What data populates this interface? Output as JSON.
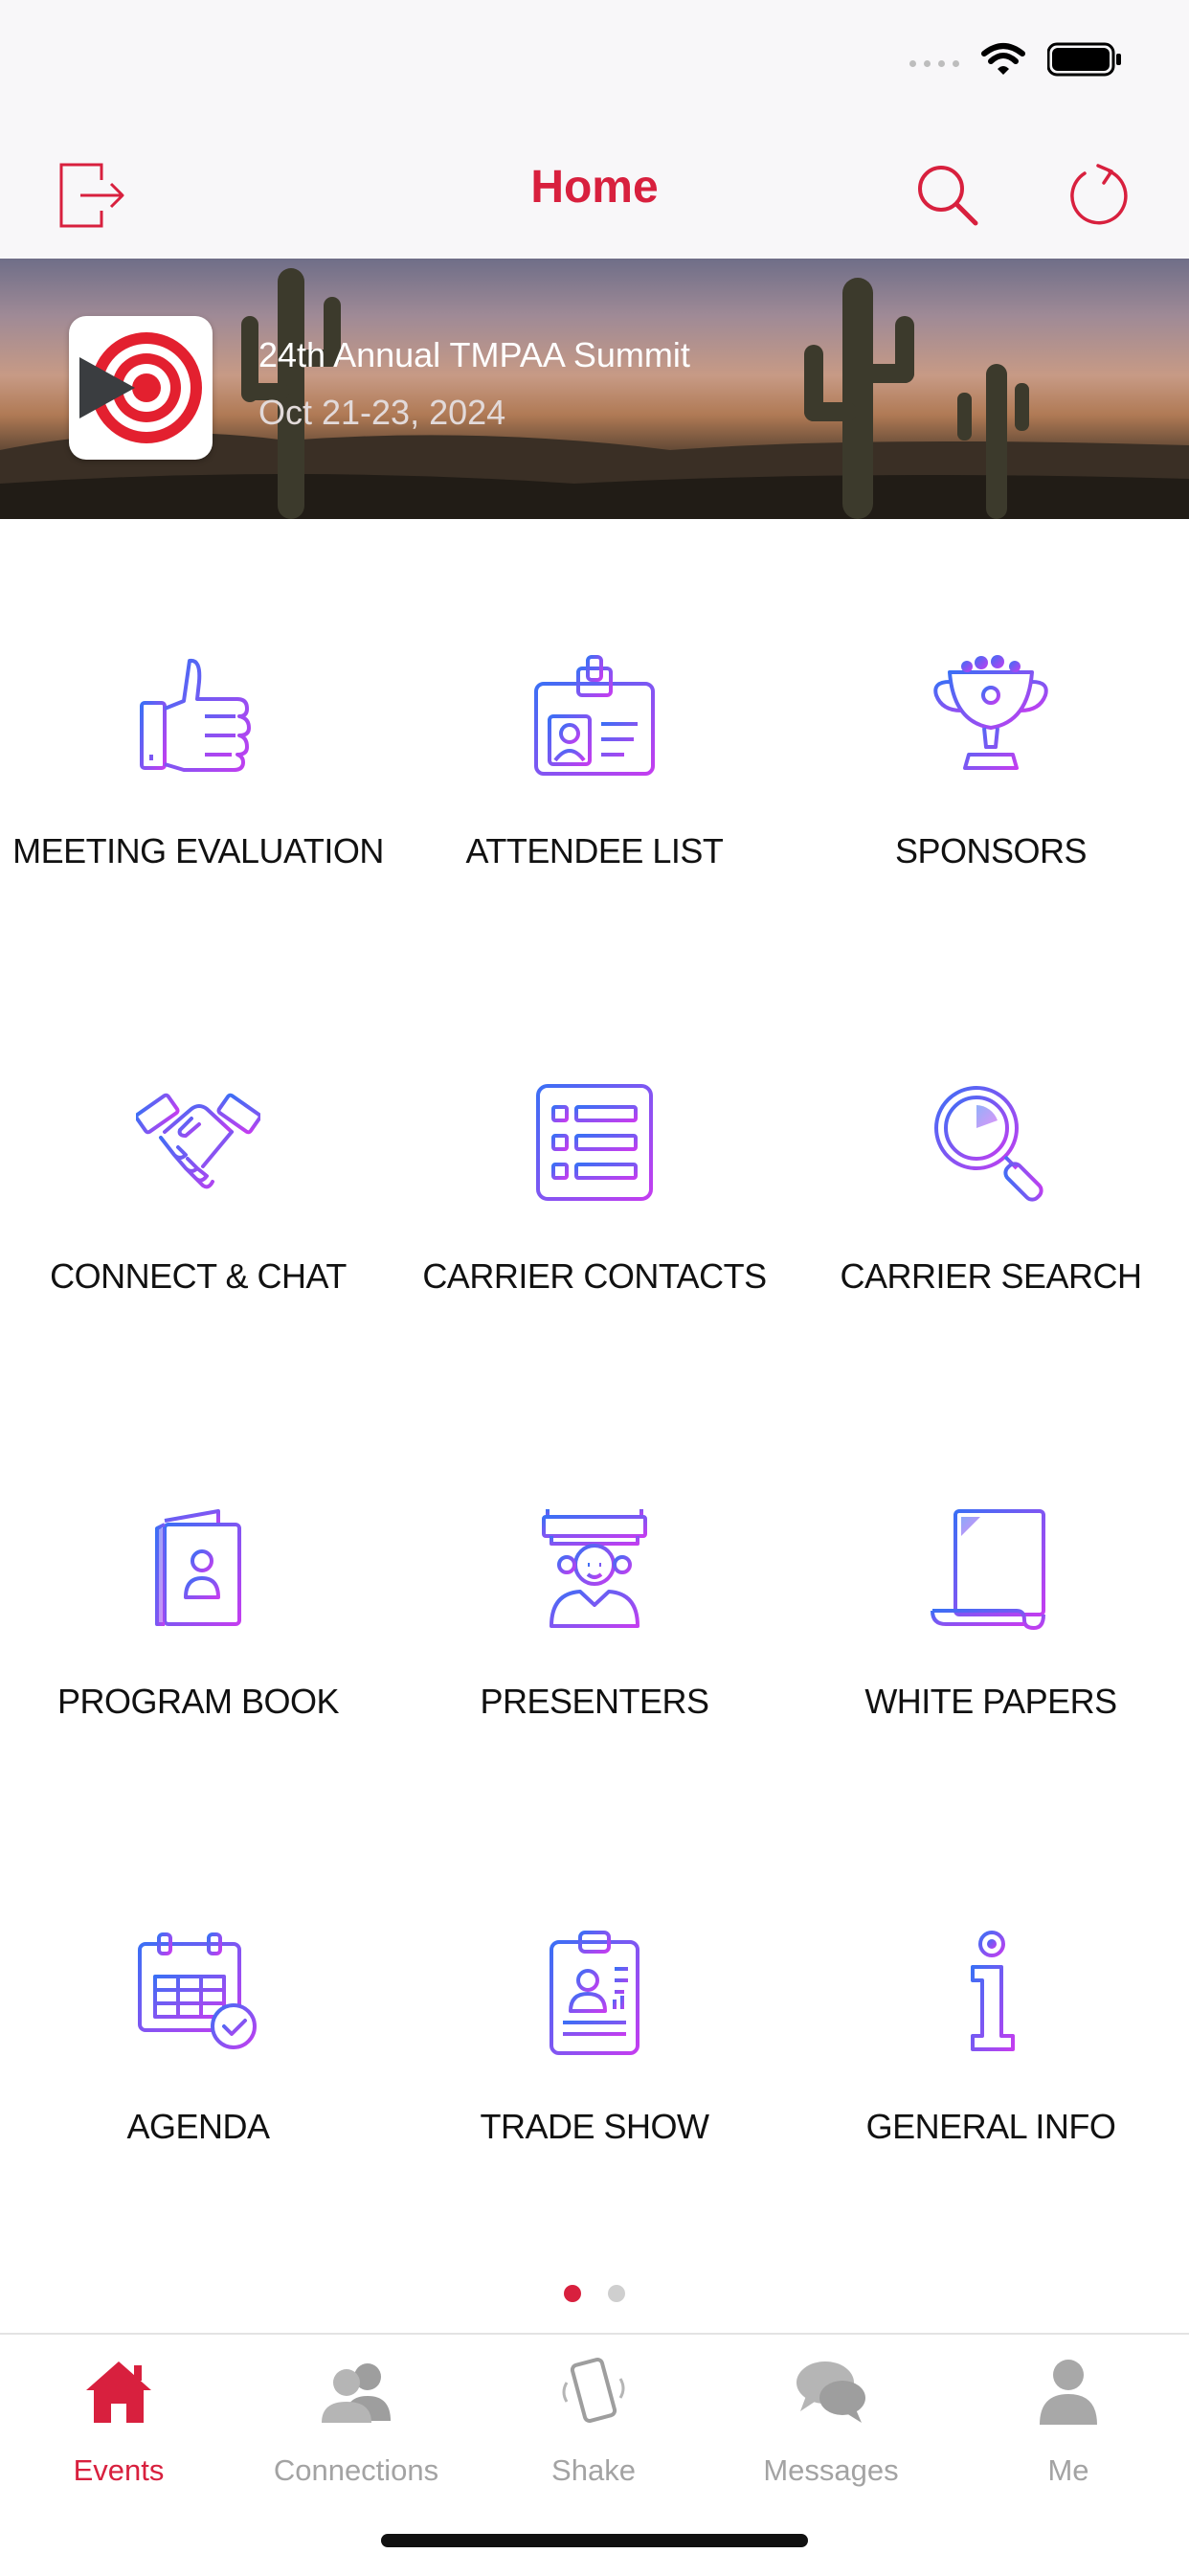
{
  "colors": {
    "accent": "#d8203e",
    "icon_gradient_start": "#3b6ff5",
    "icon_gradient_end": "#c43df0",
    "tab_inactive": "#a3a3a3"
  },
  "status_bar": {
    "icons": [
      "signal-dots-icon",
      "wifi-icon",
      "battery-icon"
    ]
  },
  "nav": {
    "title": "Home",
    "left_icon": "logout-icon",
    "right_icons": [
      "search-icon",
      "refresh-icon"
    ]
  },
  "event": {
    "title": "24th Annual TMPAA Summit",
    "dates": "Oct 21-23, 2024",
    "logo_icon": "target-logo-icon"
  },
  "grid": {
    "items": [
      {
        "label": "MEETING EVALUATION",
        "icon": "thumbs-up-icon"
      },
      {
        "label": "ATTENDEE LIST",
        "icon": "id-badge-icon"
      },
      {
        "label": "SPONSORS",
        "icon": "trophy-icon"
      },
      {
        "label": "CONNECT & CHAT",
        "icon": "handshake-icon"
      },
      {
        "label": "CARRIER CONTACTS",
        "icon": "list-icon"
      },
      {
        "label": "CARRIER SEARCH",
        "icon": "magnifier-icon"
      },
      {
        "label": "PROGRAM BOOK",
        "icon": "book-icon"
      },
      {
        "label": "PRESENTERS",
        "icon": "presenter-icon"
      },
      {
        "label": "WHITE PAPERS",
        "icon": "scroll-icon"
      },
      {
        "label": "AGENDA",
        "icon": "calendar-icon"
      },
      {
        "label": "TRADE SHOW",
        "icon": "badge-clip-icon"
      },
      {
        "label": "GENERAL INFO",
        "icon": "info-icon"
      }
    ]
  },
  "pager": {
    "pages": 2,
    "current": 1
  },
  "tabs": [
    {
      "label": "Events",
      "icon": "home-icon",
      "active": true
    },
    {
      "label": "Connections",
      "icon": "people-icon",
      "active": false
    },
    {
      "label": "Shake",
      "icon": "shake-phone-icon",
      "active": false
    },
    {
      "label": "Messages",
      "icon": "chat-bubbles-icon",
      "active": false
    },
    {
      "label": "Me",
      "icon": "person-icon",
      "active": false
    }
  ]
}
